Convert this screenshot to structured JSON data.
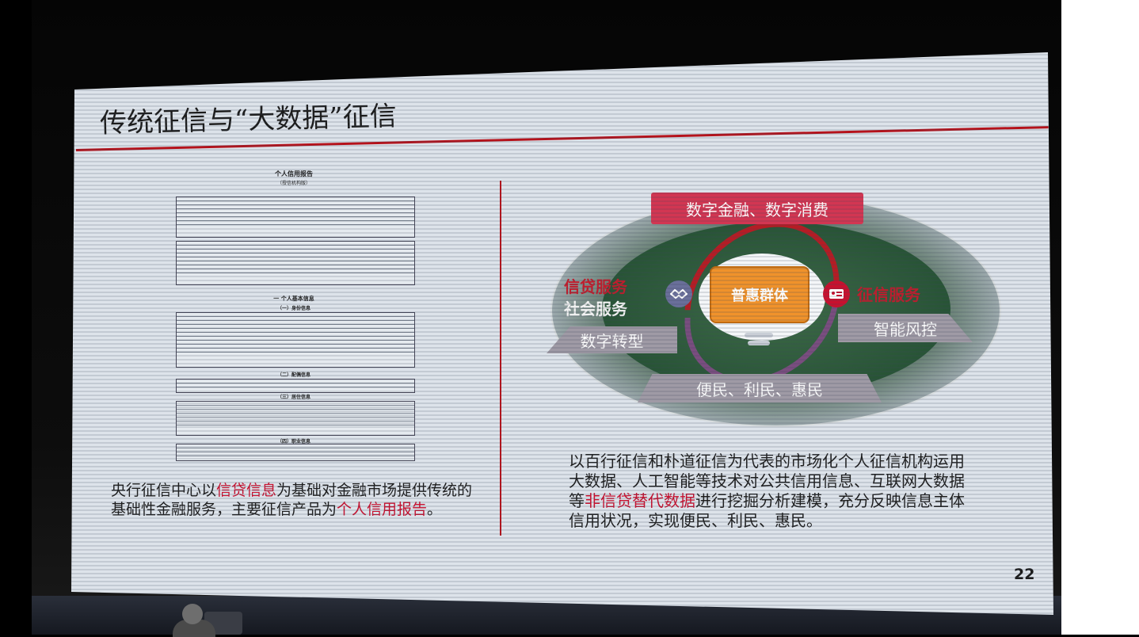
{
  "slide": {
    "title": "传统征信与“大数据”征信",
    "page_number": "22"
  },
  "report": {
    "title": "个人信用报告",
    "subtitle": "（授信机构版）",
    "section_1": "一 个人基本信息",
    "section_1a": "（一）身份信息",
    "section_1b": "（二）配偶信息",
    "section_1c": "（三）居住信息",
    "section_1d": "（四）职业信息"
  },
  "left_paragraph": {
    "part1": "央行征信中心以",
    "highlight1": "信贷信息",
    "part2": "为基础对金融市场提供传统的基础性金融服务，主要征信产品为",
    "highlight2": "个人信用报告",
    "part3": "。"
  },
  "diagram": {
    "top_banner": "数字金融、数字消费",
    "center": "普惠群体",
    "left_label_1": "信贷服务",
    "left_label_2": "社会服务",
    "right_label": "征信服务",
    "left_bottom": "数字转型",
    "right_bottom": "智能风控",
    "bottom_banner": "便民、利民、惠民",
    "left_icon": "handshake-icon",
    "right_icon": "id-card-icon"
  },
  "right_paragraph": {
    "part1": "以百行征信和朴道征信为代表的市场化个人征信机构运用大数据、人工智能等技术对公共信用信息、互联网大数据等",
    "highlight": "非信贷替代数据",
    "part2": "进行挖掘分析建模，充分反映信息主体信用状况，实现便民、利民、惠民。"
  },
  "colors": {
    "accent_red": "#c8102e",
    "banner_pink": "#d23652",
    "center_orange": "#f0922b",
    "ellipse_green": "#285436"
  }
}
